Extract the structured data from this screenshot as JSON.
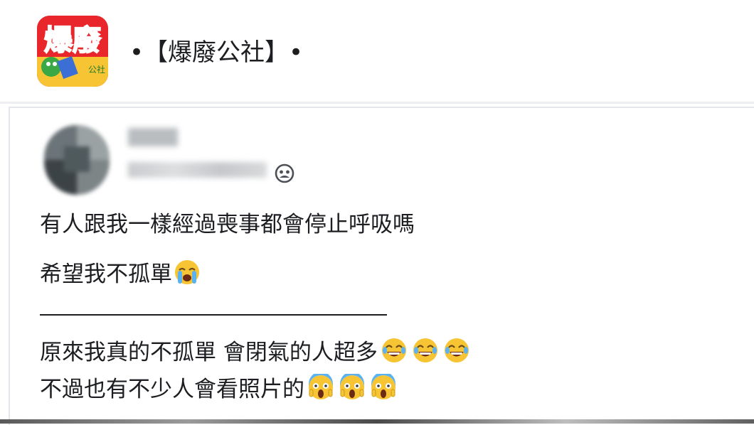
{
  "group": {
    "name": "•【爆廢公社】•",
    "logo_text": "爆廢"
  },
  "post": {
    "author_name_blurred": true,
    "privacy_icon": "group-members-icon",
    "lines": [
      "有人跟我一樣經過喪事都會停止呼吸嗎",
      "希望我不孤單",
      "原來我真的不孤單 會閉氣的人超多",
      "不過也有不少人會看照片的"
    ],
    "emoji": {
      "line2": "loudly-crying-face",
      "line3": [
        "tears-of-joy-face",
        "tears-of-joy-face",
        "tears-of-joy-face"
      ],
      "line4": [
        "screaming-in-fear-face",
        "screaming-in-fear-face",
        "screaming-in-fear-face"
      ]
    }
  },
  "colors": {
    "text": "#1c1e21",
    "logo_red": "#e8262b",
    "logo_yellow": "#ffd23f",
    "divider": "#e4e6eb"
  }
}
